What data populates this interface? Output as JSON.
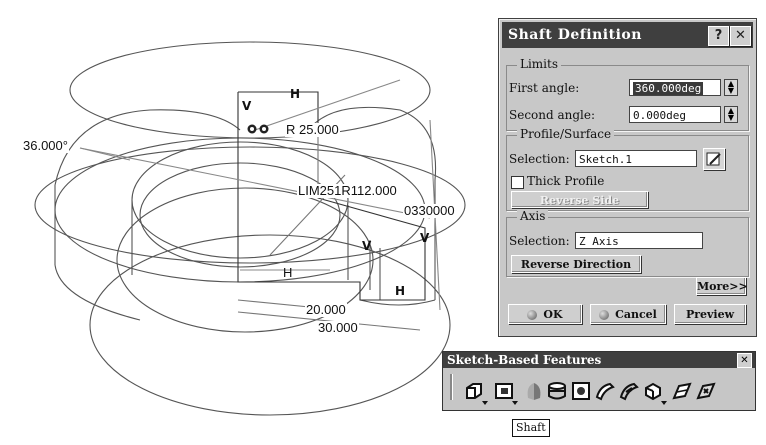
{
  "viewport": {
    "dimensions": {
      "angle": "36.000°",
      "radius": "R 25.000",
      "limit": "LIM251R112.000",
      "number": "0330000",
      "dia_inner": "20.000",
      "dia_outer": "30.000"
    },
    "constraints": {
      "h": "H",
      "v": "V",
      "h_plain": "H"
    }
  },
  "dialog": {
    "title": "Shaft Definition",
    "help_button": "?",
    "close_button": "✕",
    "limits": {
      "label": "Limits",
      "first_angle_label": "First angle:",
      "first_angle_value": "360.000deg",
      "second_angle_label": "Second angle:",
      "second_angle_value": "0.000deg"
    },
    "profile": {
      "label": "Profile/Surface",
      "selection_label": "Selection:",
      "selection_value": "Sketch.1",
      "thick_profile_label": "Thick Profile",
      "thick_profile_checked": false,
      "reverse_side_label": "Reverse Side"
    },
    "axis": {
      "label": "Axis",
      "selection_label": "Selection:",
      "selection_value": "Z Axis",
      "reverse_direction_label": "Reverse Direction"
    },
    "more_label": "More>>",
    "ok_label": "OK",
    "cancel_label": "Cancel",
    "preview_label": "Preview"
  },
  "toolbar": {
    "title": "Sketch-Based Features",
    "close": "✕",
    "icons": [
      "pad-icon",
      "pocket-icon",
      "shaft-icon",
      "groove-icon",
      "hole-icon",
      "rib-icon",
      "slot-icon",
      "stiffener-icon",
      "loft-icon",
      "remove-loft-icon"
    ]
  },
  "tooltip": {
    "text": "Shaft"
  }
}
